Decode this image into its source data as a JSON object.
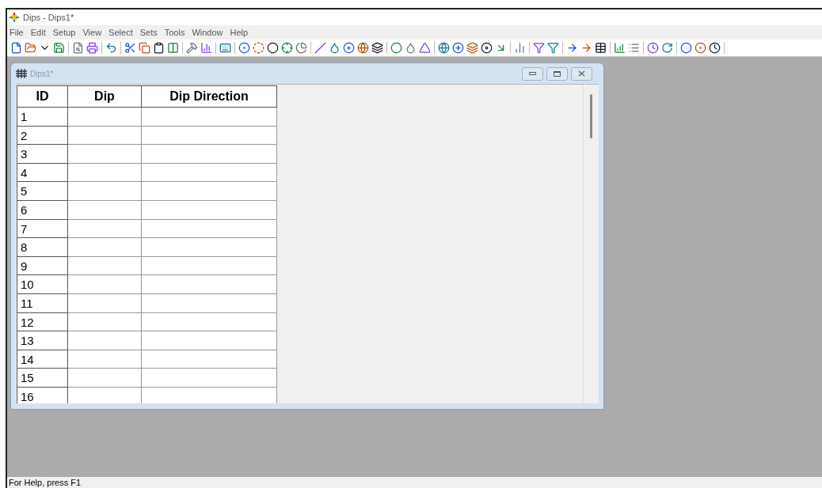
{
  "window": {
    "title": "Dips - Dips1*"
  },
  "menu": [
    "File",
    "Edit",
    "Setup",
    "View",
    "Select",
    "Sets",
    "Tools",
    "Window",
    "Help"
  ],
  "child_window": {
    "title": "Dips1*"
  },
  "table": {
    "columns": [
      "ID",
      "Dip",
      "Dip Direction"
    ],
    "rows": [
      "1",
      "2",
      "3",
      "4",
      "5",
      "6",
      "7",
      "8",
      "9",
      "10",
      "11",
      "12",
      "13",
      "14",
      "15",
      "16"
    ]
  },
  "status_bar": {
    "text": "For Help, press F1"
  }
}
